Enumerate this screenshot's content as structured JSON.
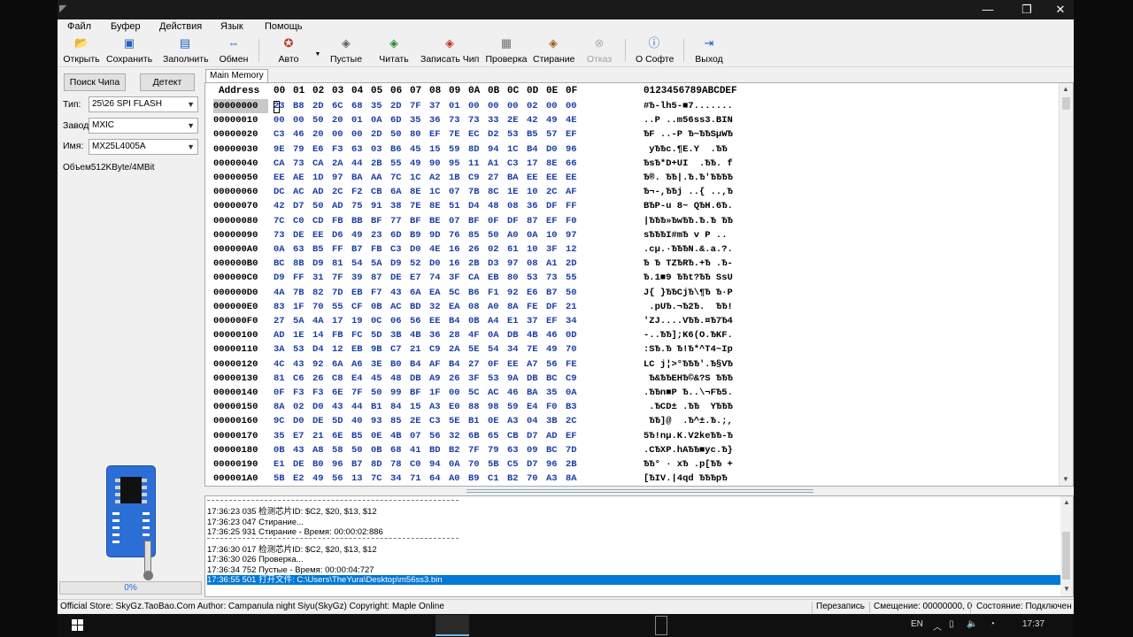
{
  "window": {
    "title": ""
  },
  "menu": [
    "Файл",
    "Буфер",
    "Действия",
    "Язык",
    "Помощь"
  ],
  "toolbar": {
    "open": "Открыть",
    "save": "Сохранить",
    "fill": "Заполнить",
    "swap": "Обмен",
    "auto": "Авто",
    "blank": "Пустые",
    "read": "Читать",
    "write": "Записать Чип",
    "verify": "Проверка",
    "erase": "Стирание",
    "cancel": "Отказ",
    "about": "О Софте",
    "exit": "Выход"
  },
  "left_panel": {
    "search_chip": "Поиск Чипа",
    "detect": "Детект",
    "type_label": "Тип:",
    "type_value": "25\\26 SPI FLASH",
    "vendor_label": "Завод:",
    "vendor_value": "MXIC",
    "name_label": "Имя:",
    "name_value": "MX25L4005A",
    "capacity": "Объем512KByte/4MBit",
    "progress": "0%",
    "progress_fraction": 0
  },
  "tab": "Main Memory",
  "hex": {
    "address_header": "Address",
    "columns": [
      "00",
      "01",
      "02",
      "03",
      "04",
      "05",
      "06",
      "07",
      "08",
      "09",
      "0A",
      "0B",
      "0C",
      "0D",
      "0E",
      "0F"
    ],
    "ascii_header": "0123456789ABCDEF",
    "rows": [
      {
        "addr": "00000000",
        "bytes": [
          "23",
          "B8",
          "2D",
          "6C",
          "68",
          "35",
          "2D",
          "7F",
          "37",
          "01",
          "00",
          "00",
          "00",
          "02",
          "00",
          "00"
        ],
        "ascii": "#Ђ-lh5-■7......."
      },
      {
        "addr": "00000010",
        "bytes": [
          "00",
          "00",
          "50",
          "20",
          "01",
          "0A",
          "6D",
          "35",
          "36",
          "73",
          "73",
          "33",
          "2E",
          "42",
          "49",
          "4E"
        ],
        "ascii": "..P ..m56ss3.BIN"
      },
      {
        "addr": "00000020",
        "bytes": [
          "C3",
          "46",
          "20",
          "00",
          "00",
          "2D",
          "50",
          "80",
          "EF",
          "7E",
          "EC",
          "D2",
          "53",
          "B5",
          "57",
          "EF"
        ],
        "ascii": "ЂF ..-P Ђ~ЂЂSµWЂ"
      },
      {
        "addr": "00000030",
        "bytes": [
          "9E",
          "79",
          "E6",
          "F3",
          "63",
          "03",
          "B6",
          "45",
          "15",
          "59",
          "8D",
          "94",
          "1C",
          "B4",
          "D0",
          "96"
        ],
        "ascii": " yЂЂc.¶E.Y  .ЂЂ"
      },
      {
        "addr": "00000040",
        "bytes": [
          "CA",
          "73",
          "CA",
          "2A",
          "44",
          "2B",
          "55",
          "49",
          "90",
          "95",
          "11",
          "A1",
          "C3",
          "17",
          "8E",
          "66"
        ],
        "ascii": "ЂsЂ*D+UI  .ЂЂ. f"
      },
      {
        "addr": "00000050",
        "bytes": [
          "EE",
          "AE",
          "1D",
          "97",
          "BA",
          "AA",
          "7C",
          "1C",
          "A2",
          "1B",
          "C9",
          "27",
          "BA",
          "EE",
          "EE",
          "EE"
        ],
        "ascii": "Ђ®. ЂЂ|.Ђ.Ђ'ЂЂЂЂ"
      },
      {
        "addr": "00000060",
        "bytes": [
          "DC",
          "AC",
          "AD",
          "2C",
          "F2",
          "CB",
          "6A",
          "8E",
          "1C",
          "07",
          "7B",
          "8C",
          "1E",
          "10",
          "2C",
          "AF"
        ],
        "ascii": "Ђ¬-,ЂЂj ..{ ..,Ђ"
      },
      {
        "addr": "00000070",
        "bytes": [
          "42",
          "D7",
          "50",
          "AD",
          "75",
          "91",
          "38",
          "7E",
          "8E",
          "51",
          "D4",
          "48",
          "08",
          "36",
          "DF",
          "FF"
        ],
        "ascii": "BЂP-u 8~ QЂH.6Ђ."
      },
      {
        "addr": "00000080",
        "bytes": [
          "7C",
          "C0",
          "CD",
          "FB",
          "BB",
          "BF",
          "77",
          "BF",
          "BE",
          "07",
          "BF",
          "0F",
          "DF",
          "87",
          "EF",
          "F0"
        ],
        "ascii": "|ЂЂЂ»ЂwЂЂ.Ђ.Ђ ЂЂ"
      },
      {
        "addr": "00000090",
        "bytes": [
          "73",
          "DE",
          "EE",
          "D6",
          "49",
          "23",
          "6D",
          "B9",
          "9D",
          "76",
          "85",
          "50",
          "A0",
          "0A",
          "10",
          "97"
        ],
        "ascii": "sЂЂЂI#mЂ v P .. "
      },
      {
        "addr": "000000A0",
        "bytes": [
          "0A",
          "63",
          "B5",
          "FF",
          "B7",
          "FB",
          "C3",
          "D0",
          "4E",
          "16",
          "26",
          "02",
          "61",
          "10",
          "3F",
          "12"
        ],
        "ascii": ".cµ.·ЂЂЂN.&.a.?."
      },
      {
        "addr": "000000B0",
        "bytes": [
          "BC",
          "8B",
          "D9",
          "81",
          "54",
          "5A",
          "D9",
          "52",
          "D0",
          "16",
          "2B",
          "D3",
          "97",
          "08",
          "A1",
          "2D"
        ],
        "ascii": "Ђ Ђ TZЂRЂ.+Ђ .Ђ-"
      },
      {
        "addr": "000000C0",
        "bytes": [
          "D9",
          "FF",
          "31",
          "7F",
          "39",
          "87",
          "DE",
          "E7",
          "74",
          "3F",
          "CA",
          "EB",
          "80",
          "53",
          "73",
          "55"
        ],
        "ascii": "Ђ.1■9 ЂЂt?ЂЂ SsU"
      },
      {
        "addr": "000000D0",
        "bytes": [
          "4A",
          "7B",
          "82",
          "7D",
          "EB",
          "F7",
          "43",
          "6A",
          "EA",
          "5C",
          "B6",
          "F1",
          "92",
          "E6",
          "B7",
          "50"
        ],
        "ascii": "J{ }ЂЂCjЂ\\¶Ђ Ђ·P"
      },
      {
        "addr": "000000E0",
        "bytes": [
          "83",
          "1F",
          "70",
          "55",
          "CF",
          "0B",
          "AC",
          "BD",
          "32",
          "EA",
          "08",
          "A0",
          "8A",
          "FE",
          "DF",
          "21"
        ],
        "ascii": " .pUЂ.¬Ђ2Ђ.  ЂЂ!"
      },
      {
        "addr": "000000F0",
        "bytes": [
          "27",
          "5A",
          "4A",
          "17",
          "19",
          "0C",
          "06",
          "56",
          "EE",
          "B4",
          "0B",
          "A4",
          "E1",
          "37",
          "EF",
          "34"
        ],
        "ascii": "'ZJ....VЂЂ.¤Ђ7Ђ4"
      },
      {
        "addr": "00000100",
        "bytes": [
          "AD",
          "1E",
          "14",
          "FB",
          "FC",
          "5D",
          "3B",
          "4B",
          "36",
          "28",
          "4F",
          "0A",
          "DB",
          "4B",
          "46",
          "0D"
        ],
        "ascii": "-..ЂЂ];K6(O.ЂKF."
      },
      {
        "addr": "00000110",
        "bytes": [
          "3A",
          "53",
          "D4",
          "12",
          "EB",
          "9B",
          "C7",
          "21",
          "C9",
          "2A",
          "5E",
          "54",
          "34",
          "7E",
          "49",
          "70"
        ],
        "ascii": ":SЂ.Ђ Ђ!Ђ*^T4~Ip"
      },
      {
        "addr": "00000120",
        "bytes": [
          "4C",
          "43",
          "92",
          "6A",
          "A6",
          "3E",
          "B0",
          "B4",
          "AF",
          "B4",
          "27",
          "0F",
          "EE",
          "A7",
          "56",
          "FE"
        ],
        "ascii": "LC j¦>°ЂЂЂ'.Ђ§VЂ"
      },
      {
        "addr": "00000130",
        "bytes": [
          "81",
          "C6",
          "26",
          "C8",
          "E4",
          "45",
          "48",
          "DB",
          "A9",
          "26",
          "3F",
          "53",
          "9A",
          "DB",
          "BC",
          "C9"
        ],
        "ascii": " Ђ&ЂЂEHЂ©&?S ЂЂЂ"
      },
      {
        "addr": "00000140",
        "bytes": [
          "0F",
          "F3",
          "F3",
          "6E",
          "7F",
          "50",
          "99",
          "BF",
          "1F",
          "00",
          "5C",
          "AC",
          "46",
          "BA",
          "35",
          "0A"
        ],
        "ascii": ".ЂЂn■P Ђ..\\¬FЂ5."
      },
      {
        "addr": "00000150",
        "bytes": [
          "8A",
          "02",
          "D0",
          "43",
          "44",
          "B1",
          "84",
          "15",
          "A3",
          "E0",
          "88",
          "98",
          "59",
          "E4",
          "F0",
          "B3"
        ],
        "ascii": " .ЂCD± .ЂЂ  YЂЂЂ"
      },
      {
        "addr": "00000160",
        "bytes": [
          "9C",
          "D0",
          "DE",
          "5D",
          "40",
          "93",
          "85",
          "2E",
          "C3",
          "5E",
          "B1",
          "0E",
          "A3",
          "04",
          "3B",
          "2C"
        ],
        "ascii": " ЂЂ]@  .Ђ^±.Ђ.;,"
      },
      {
        "addr": "00000170",
        "bytes": [
          "35",
          "E7",
          "21",
          "6E",
          "B5",
          "0E",
          "4B",
          "07",
          "56",
          "32",
          "6B",
          "65",
          "CB",
          "D7",
          "AD",
          "EF"
        ],
        "ascii": "5Ђ!nµ.K.V2keЂЂ-Ђ"
      },
      {
        "addr": "00000180",
        "bytes": [
          "0B",
          "43",
          "A8",
          "58",
          "50",
          "0B",
          "68",
          "41",
          "BD",
          "B2",
          "7F",
          "79",
          "63",
          "09",
          "BC",
          "7D"
        ],
        "ascii": ".CЂXP.hAЂЂ■yc.Ђ}"
      },
      {
        "addr": "00000190",
        "bytes": [
          "E1",
          "DE",
          "B0",
          "96",
          "B7",
          "8D",
          "78",
          "C0",
          "94",
          "0A",
          "70",
          "5B",
          "C5",
          "D7",
          "96",
          "2B"
        ],
        "ascii": "ЂЂ° · xЂ .p[ЂЂ +"
      },
      {
        "addr": "000001A0",
        "bytes": [
          "5B",
          "E2",
          "49",
          "56",
          "13",
          "7C",
          "34",
          "71",
          "64",
          "A0",
          "B9",
          "C1",
          "B2",
          "70",
          "A3",
          "8A"
        ],
        "ascii": "[ЂIV.|4qd ЂЂЂpЂ "
      }
    ]
  },
  "log": [
    {
      "type": "sep"
    },
    {
      "type": "line",
      "text": "17:36:23 035 检测芯片ID: $C2, $20, $13, $12"
    },
    {
      "type": "line",
      "text": "17:36:23 047 Стирание..."
    },
    {
      "type": "line",
      "text": "17:36:25 931 Стирание - Время: 00:00:02:886"
    },
    {
      "type": "sep"
    },
    {
      "type": "line",
      "text": "17:36:30 017 检测芯片ID: $C2, $20, $13, $12"
    },
    {
      "type": "line",
      "text": "17:36:30 026 Проверка..."
    },
    {
      "type": "line",
      "text": "17:36:34 752 Пустые - Время: 00:00:04:727"
    },
    {
      "type": "line",
      "text": "17:36:55 501 打开文件: C:\\Users\\TheYura\\Desktop\\m56ss3.bin",
      "selected": true
    }
  ],
  "status": {
    "store": "Official Store: SkyGz.TaoBao.Com Author: Campanula night Siyu(SkyGz) Copyright: Maple Online",
    "mode": "Перезапись",
    "offset": "Смещение: 00000000, 0",
    "state": "Состояние: Подключен"
  },
  "taskbar": {
    "lang": "EN",
    "time": "17:37"
  }
}
